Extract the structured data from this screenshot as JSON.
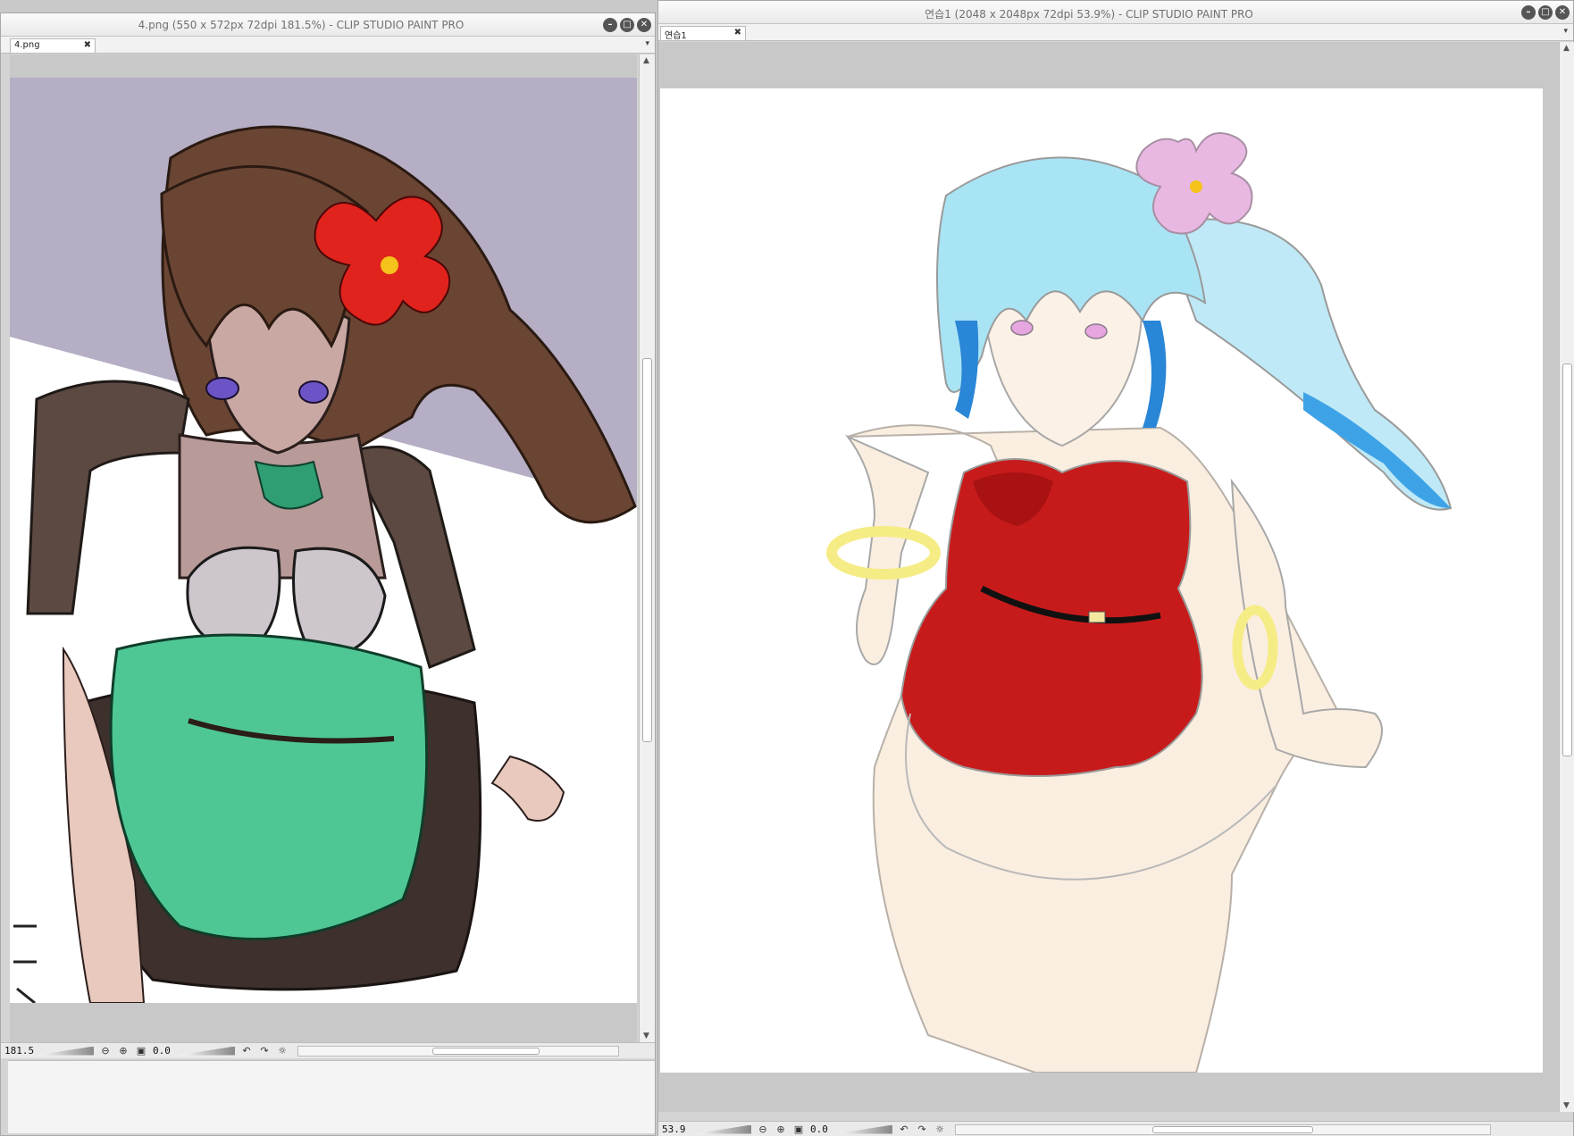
{
  "left_window": {
    "title": "4.png (550 x 572px 72dpi 181.5%)  - CLIP STUDIO PAINT PRO",
    "tab_label": "4.png",
    "zoom": "181.5",
    "rotation": "0.0"
  },
  "right_window": {
    "title": "연습1 (2048 x 2048px 72dpi 53.9%)  - CLIP STUDIO PAINT PRO",
    "tab_label": "연습1",
    "zoom": "53.9",
    "rotation": "0.0"
  },
  "icons": {
    "minimize": "minimize-icon",
    "maximize": "maximize-icon",
    "close": "close-icon",
    "zoom_out": "zoom-out-icon",
    "zoom_in": "zoom-in-icon",
    "fit": "fit-screen-icon",
    "rotate_left": "rotate-left-icon",
    "rotate_right": "rotate-right-icon",
    "reset_rotation": "reset-rotation-icon"
  },
  "colors": {
    "left_bg_lavender": "#b5aec4",
    "left_skirt_green": "#4fc794",
    "left_hair_brown": "#6b4533",
    "left_flower_red": "#e0231c",
    "right_dress_red": "#c71b1b",
    "right_hair_cyan": "#7fd8f0",
    "right_skin": "#faeee0",
    "right_flower_pink": "#e8b8e2",
    "right_bracelet_yellow": "#f6ec86"
  }
}
